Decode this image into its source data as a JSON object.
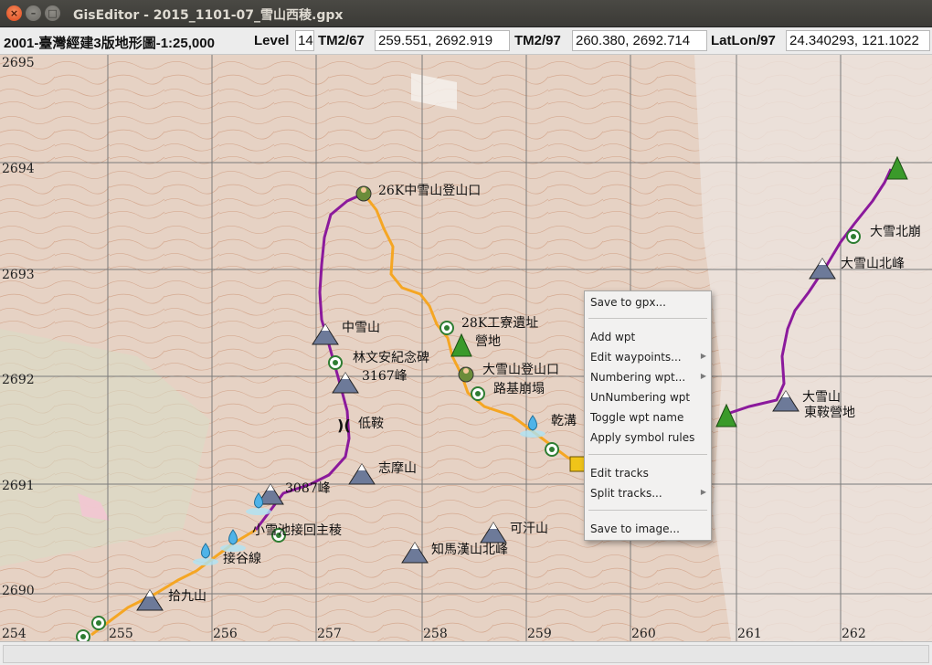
{
  "window": {
    "title": "GisEditor - 2015_1101-07_雪山西稜.gpx"
  },
  "toolbar": {
    "map_name": "2001-臺灣經建3版地形圖-1:25,000",
    "level_label": "Level",
    "level_value": "14",
    "tm2_67_label": "TM2/67",
    "tm2_67_value": "259.551, 2692.919",
    "tm2_97_label": "TM2/97",
    "tm2_97_value": "260.380, 2692.714",
    "latlon_label": "LatLon/97",
    "latlon_value": "24.340293, 121.1022"
  },
  "map": {
    "y_ticks": [
      "2695",
      "2694",
      "2693",
      "2692",
      "2691",
      "2690"
    ],
    "x_ticks": [
      "254",
      "256",
      "257",
      "258",
      "259",
      "260",
      "261",
      "262"
    ],
    "x_tick_partial": "255",
    "track_colors": {
      "purple": "#8b1a9c",
      "orange": "#f5a623"
    },
    "waypoints": [
      {
        "name": "26K中雪山登山口",
        "icon": "hiker-icon"
      },
      {
        "name": "28K工寮遺址",
        "icon": "waypoint-circle-icon"
      },
      {
        "name": "營地",
        "icon": "campsite-icon"
      },
      {
        "name": "大雪山登山口",
        "icon": "hiker-icon"
      },
      {
        "name": "路基崩塌",
        "icon": "waypoint-circle-icon"
      },
      {
        "name": "中雪山",
        "icon": "summit-icon"
      },
      {
        "name": "林文安紀念碑",
        "icon": "waypoint-circle-icon"
      },
      {
        "name": "3167峰",
        "icon": "summit-icon"
      },
      {
        "name": "低鞍",
        "icon": "saddle-icon"
      },
      {
        "name": "志摩山",
        "icon": "summit-icon"
      },
      {
        "name": "3087峰",
        "icon": "summit-icon"
      },
      {
        "name": "小雪池接回主稜",
        "icon": "water-icon"
      },
      {
        "name": "接谷線",
        "icon": "water-icon"
      },
      {
        "name": "乾溝",
        "icon": "water-icon"
      },
      {
        "name": "知馬漢山北峰",
        "icon": "summit-icon"
      },
      {
        "name": "可汗山",
        "icon": "summit-icon"
      },
      {
        "name": "拾九山",
        "icon": "summit-icon"
      },
      {
        "name": "大雪山",
        "icon": "summit-icon"
      },
      {
        "name": "大雪山北峰",
        "icon": "summit-icon"
      },
      {
        "name": "大雪北崩",
        "icon": "waypoint-circle-icon"
      },
      {
        "name": "東鞍營地",
        "icon": "campsite-icon"
      }
    ]
  },
  "context_menu": {
    "items": [
      {
        "label": "Save to gpx...",
        "submenu": false
      },
      {
        "label": "Add wpt",
        "submenu": false
      },
      {
        "label": "Edit waypoints...",
        "submenu": true
      },
      {
        "label": "Numbering wpt...",
        "submenu": true
      },
      {
        "label": "UnNumbering wpt",
        "submenu": false
      },
      {
        "label": "Toggle wpt name",
        "submenu": false
      },
      {
        "label": "Apply symbol rules",
        "submenu": false
      },
      {
        "label": "Edit tracks",
        "submenu": false
      },
      {
        "label": "Split tracks...",
        "submenu": true
      },
      {
        "label": "Save to image...",
        "submenu": false
      }
    ]
  }
}
